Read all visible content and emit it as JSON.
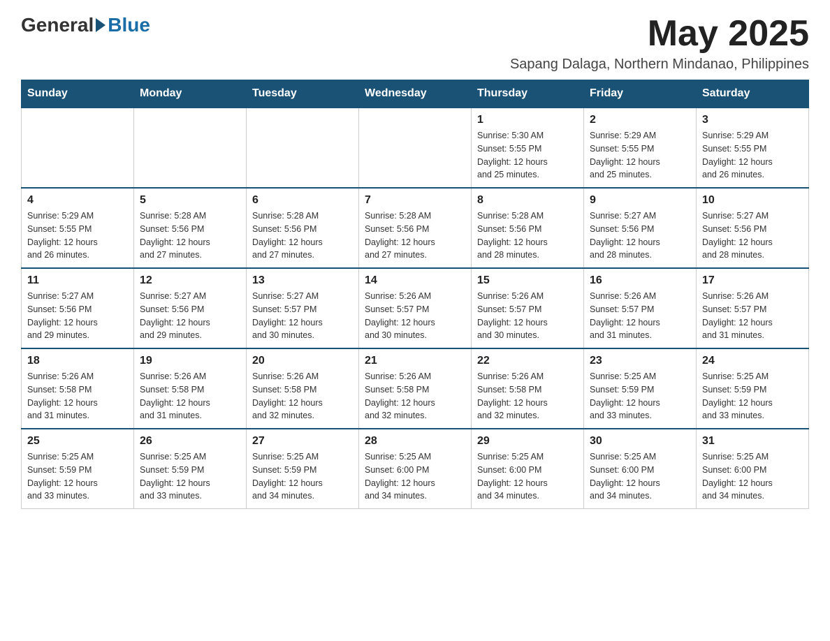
{
  "logo": {
    "general": "General",
    "blue": "Blue"
  },
  "header": {
    "month": "May 2025",
    "location": "Sapang Dalaga, Northern Mindanao, Philippines"
  },
  "days_of_week": [
    "Sunday",
    "Monday",
    "Tuesday",
    "Wednesday",
    "Thursday",
    "Friday",
    "Saturday"
  ],
  "weeks": [
    [
      {
        "day": "",
        "info": ""
      },
      {
        "day": "",
        "info": ""
      },
      {
        "day": "",
        "info": ""
      },
      {
        "day": "",
        "info": ""
      },
      {
        "day": "1",
        "info": "Sunrise: 5:30 AM\nSunset: 5:55 PM\nDaylight: 12 hours\nand 25 minutes."
      },
      {
        "day": "2",
        "info": "Sunrise: 5:29 AM\nSunset: 5:55 PM\nDaylight: 12 hours\nand 25 minutes."
      },
      {
        "day": "3",
        "info": "Sunrise: 5:29 AM\nSunset: 5:55 PM\nDaylight: 12 hours\nand 26 minutes."
      }
    ],
    [
      {
        "day": "4",
        "info": "Sunrise: 5:29 AM\nSunset: 5:55 PM\nDaylight: 12 hours\nand 26 minutes."
      },
      {
        "day": "5",
        "info": "Sunrise: 5:28 AM\nSunset: 5:56 PM\nDaylight: 12 hours\nand 27 minutes."
      },
      {
        "day": "6",
        "info": "Sunrise: 5:28 AM\nSunset: 5:56 PM\nDaylight: 12 hours\nand 27 minutes."
      },
      {
        "day": "7",
        "info": "Sunrise: 5:28 AM\nSunset: 5:56 PM\nDaylight: 12 hours\nand 27 minutes."
      },
      {
        "day": "8",
        "info": "Sunrise: 5:28 AM\nSunset: 5:56 PM\nDaylight: 12 hours\nand 28 minutes."
      },
      {
        "day": "9",
        "info": "Sunrise: 5:27 AM\nSunset: 5:56 PM\nDaylight: 12 hours\nand 28 minutes."
      },
      {
        "day": "10",
        "info": "Sunrise: 5:27 AM\nSunset: 5:56 PM\nDaylight: 12 hours\nand 28 minutes."
      }
    ],
    [
      {
        "day": "11",
        "info": "Sunrise: 5:27 AM\nSunset: 5:56 PM\nDaylight: 12 hours\nand 29 minutes."
      },
      {
        "day": "12",
        "info": "Sunrise: 5:27 AM\nSunset: 5:56 PM\nDaylight: 12 hours\nand 29 minutes."
      },
      {
        "day": "13",
        "info": "Sunrise: 5:27 AM\nSunset: 5:57 PM\nDaylight: 12 hours\nand 30 minutes."
      },
      {
        "day": "14",
        "info": "Sunrise: 5:26 AM\nSunset: 5:57 PM\nDaylight: 12 hours\nand 30 minutes."
      },
      {
        "day": "15",
        "info": "Sunrise: 5:26 AM\nSunset: 5:57 PM\nDaylight: 12 hours\nand 30 minutes."
      },
      {
        "day": "16",
        "info": "Sunrise: 5:26 AM\nSunset: 5:57 PM\nDaylight: 12 hours\nand 31 minutes."
      },
      {
        "day": "17",
        "info": "Sunrise: 5:26 AM\nSunset: 5:57 PM\nDaylight: 12 hours\nand 31 minutes."
      }
    ],
    [
      {
        "day": "18",
        "info": "Sunrise: 5:26 AM\nSunset: 5:58 PM\nDaylight: 12 hours\nand 31 minutes."
      },
      {
        "day": "19",
        "info": "Sunrise: 5:26 AM\nSunset: 5:58 PM\nDaylight: 12 hours\nand 31 minutes."
      },
      {
        "day": "20",
        "info": "Sunrise: 5:26 AM\nSunset: 5:58 PM\nDaylight: 12 hours\nand 32 minutes."
      },
      {
        "day": "21",
        "info": "Sunrise: 5:26 AM\nSunset: 5:58 PM\nDaylight: 12 hours\nand 32 minutes."
      },
      {
        "day": "22",
        "info": "Sunrise: 5:26 AM\nSunset: 5:58 PM\nDaylight: 12 hours\nand 32 minutes."
      },
      {
        "day": "23",
        "info": "Sunrise: 5:25 AM\nSunset: 5:59 PM\nDaylight: 12 hours\nand 33 minutes."
      },
      {
        "day": "24",
        "info": "Sunrise: 5:25 AM\nSunset: 5:59 PM\nDaylight: 12 hours\nand 33 minutes."
      }
    ],
    [
      {
        "day": "25",
        "info": "Sunrise: 5:25 AM\nSunset: 5:59 PM\nDaylight: 12 hours\nand 33 minutes."
      },
      {
        "day": "26",
        "info": "Sunrise: 5:25 AM\nSunset: 5:59 PM\nDaylight: 12 hours\nand 33 minutes."
      },
      {
        "day": "27",
        "info": "Sunrise: 5:25 AM\nSunset: 5:59 PM\nDaylight: 12 hours\nand 34 minutes."
      },
      {
        "day": "28",
        "info": "Sunrise: 5:25 AM\nSunset: 6:00 PM\nDaylight: 12 hours\nand 34 minutes."
      },
      {
        "day": "29",
        "info": "Sunrise: 5:25 AM\nSunset: 6:00 PM\nDaylight: 12 hours\nand 34 minutes."
      },
      {
        "day": "30",
        "info": "Sunrise: 5:25 AM\nSunset: 6:00 PM\nDaylight: 12 hours\nand 34 minutes."
      },
      {
        "day": "31",
        "info": "Sunrise: 5:25 AM\nSunset: 6:00 PM\nDaylight: 12 hours\nand 34 minutes."
      }
    ]
  ]
}
